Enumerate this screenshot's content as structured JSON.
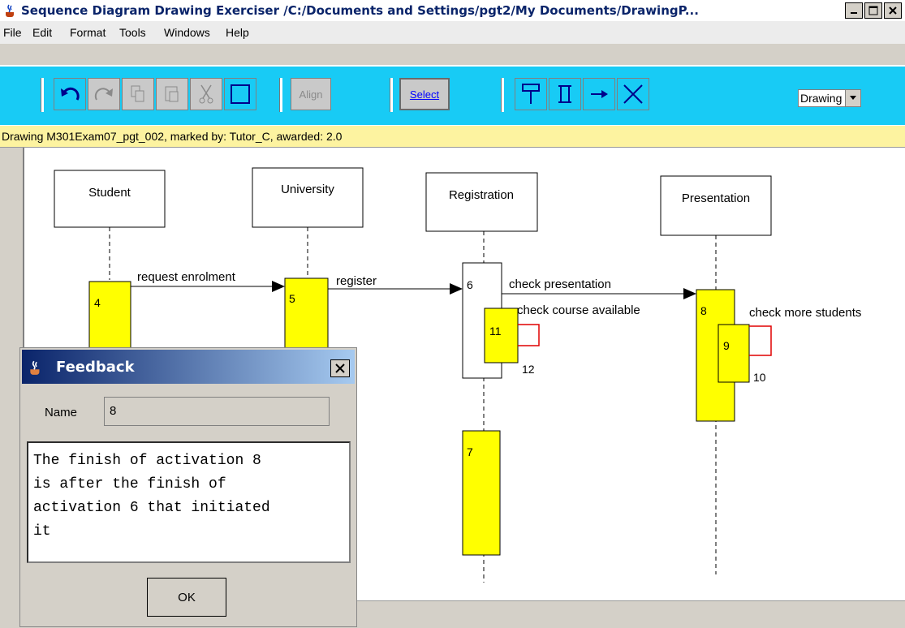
{
  "window": {
    "title": "Sequence Diagram Drawing Exerciser  /C:/Documents and Settings/pgt2/My Documents/DrawingP..."
  },
  "menu": [
    "File",
    "Edit",
    "Format",
    "Tools",
    "Windows",
    "Help"
  ],
  "toolbar": {
    "align_label": "Align",
    "select_label": "Select",
    "mode_value": "Drawing",
    "icons": [
      "undo-icon",
      "redo-icon",
      "copy-icon",
      "paste-icon",
      "cut-icon",
      "rectangle-icon",
      "object-tool-icon",
      "activation-tool-icon",
      "message-tool-icon",
      "self-message-tool-icon"
    ]
  },
  "status": {
    "text": "Drawing M301Exam07_pgt_002, marked by: Tutor_C, awarded: 2.0"
  },
  "diagram": {
    "objects": [
      "Student",
      "University",
      "Registration",
      "Presentation"
    ],
    "messages": [
      "request enrolment",
      "register",
      "check presentation",
      "check course available",
      "check more students"
    ],
    "activations": [
      "4",
      "5",
      "6",
      "7",
      "8",
      "9",
      "10",
      "11",
      "12"
    ]
  },
  "feedback": {
    "title": "Feedback",
    "name_label": "Name",
    "name_value": "8",
    "message_lines": [
      "The finish of activation 8",
      "is after the finish of",
      "activation 6 that initiated",
      "it"
    ],
    "ok_label": "OK"
  },
  "colors": {
    "toolbar": "#18cbf5",
    "status": "#fdf3a0",
    "activation": "#ffff00",
    "self_call": "#e00000"
  }
}
